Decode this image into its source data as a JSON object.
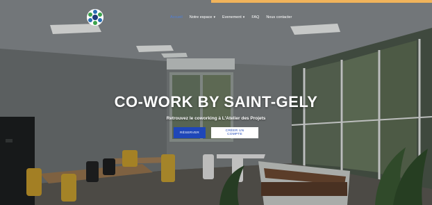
{
  "colors": {
    "accent": "#f0b35b",
    "primary_button": "#1f47b8",
    "active_nav": "#4f7fd9"
  },
  "logo": {
    "icon": "coworking-logo-icon"
  },
  "nav": {
    "items": [
      {
        "label": "Accueil",
        "active": true,
        "has_dropdown": false
      },
      {
        "label": "Notre espace",
        "active": false,
        "has_dropdown": true
      },
      {
        "label": "Evenement",
        "active": false,
        "has_dropdown": true
      },
      {
        "label": "FAQ",
        "active": false,
        "has_dropdown": false
      },
      {
        "label": "Nous contacter",
        "active": false,
        "has_dropdown": false
      }
    ]
  },
  "hero": {
    "title": "CO-WORK BY SAINT-GELY",
    "subtitle": "Retrouvez le coworking à L'Atelier des Projets",
    "primary_button": "RÉSERVER",
    "secondary_button": "CRÉER UN COMPTE"
  }
}
